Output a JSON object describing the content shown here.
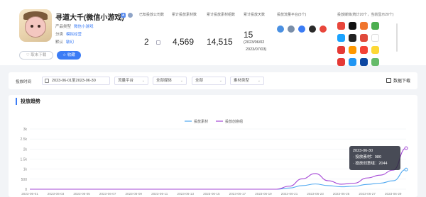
{
  "app": {
    "title": "寻道大千(微信小游戏)",
    "product_type_label": "产品类型",
    "product_type_value": "微信小游戏",
    "category_label": "分类",
    "category_value": "模拟经营",
    "studio_label": "默认",
    "studio_value": "敏幻",
    "unpublish_label": "取未下载",
    "favorite_label": "收藏"
  },
  "stats": {
    "companies_label": "已知投放公司数",
    "companies_value": "2",
    "materials_label": "累计投放素材数",
    "materials_value": "4,569",
    "creatives_label": "累计投放素材组数",
    "creatives_value": "14,515",
    "days_label": "累计投放天数",
    "days_value": "15",
    "days_range_start": "(2023/06/02",
    "days_range_end": "2023/07/03)",
    "platforms_label": "投放流量平台(5个)",
    "media_label": "投放媒体(统计20个，当前显示20个)"
  },
  "filters": {
    "time_label": "投放时间",
    "date_range": "2023-06-01至2023-06-30",
    "traffic_platform": "流量平台",
    "all_media": "全部媒体",
    "all": "全部",
    "material_type": "素材类型",
    "download_label": "数据下载"
  },
  "colors": {
    "accent": "#3b7cf5",
    "series_material": "#4fa8f0",
    "series_creative": "#a548d6"
  },
  "chart_data": {
    "type": "line",
    "title": "投放趋势",
    "x": [
      "2023-06-01",
      "2023-06-02",
      "2023-06-03",
      "2023-06-04",
      "2023-06-05",
      "2023-06-06",
      "2023-06-07",
      "2023-06-08",
      "2023-06-09",
      "2023-06-10",
      "2023-06-11",
      "2023-06-12",
      "2023-06-13",
      "2023-06-14",
      "2023-06-15",
      "2023-06-16",
      "2023-06-17",
      "2023-06-18",
      "2023-06-19",
      "2023-06-20",
      "2023-06-21",
      "2023-06-22",
      "2023-06-23",
      "2023-06-24",
      "2023-06-25",
      "2023-06-26",
      "2023-06-27",
      "2023-06-28",
      "2023-06-29",
      "2023-06-30"
    ],
    "x_tick_labels": [
      "2023-06-01",
      "2023-06-03",
      "2023-06-05",
      "2023-06-07",
      "2023-06-09",
      "2023-06-11",
      "2023-06-13",
      "2023-06-15",
      "2023-06-17",
      "2023-06-19",
      "2023-06-21",
      "2023-06-23",
      "2023-06-25",
      "2023-06-27",
      "2023-06-29"
    ],
    "y_ticks": [
      "0",
      "500",
      "1k",
      "1.5k",
      "2k",
      "2.5k",
      "3k"
    ],
    "ylim": [
      0,
      3000
    ],
    "series": [
      {
        "name": "投放素材",
        "values": [
          0,
          0,
          0,
          0,
          0,
          0,
          0,
          0,
          0,
          0,
          0,
          0,
          0,
          0,
          0,
          0,
          0,
          0,
          0,
          0,
          60,
          180,
          260,
          180,
          120,
          150,
          240,
          300,
          420,
          980
        ]
      },
      {
        "name": "投放创意组",
        "values": [
          0,
          0,
          0,
          0,
          0,
          0,
          0,
          0,
          0,
          0,
          0,
          0,
          0,
          0,
          0,
          0,
          0,
          0,
          0,
          0,
          150,
          520,
          780,
          420,
          250,
          300,
          560,
          700,
          950,
          2044
        ]
      }
    ],
    "tooltip": {
      "date": "2023-06-30",
      "line1": "· 投放素材：980",
      "line2": "· 投放创意组：2044"
    },
    "grid": true,
    "legend_position": "top"
  }
}
